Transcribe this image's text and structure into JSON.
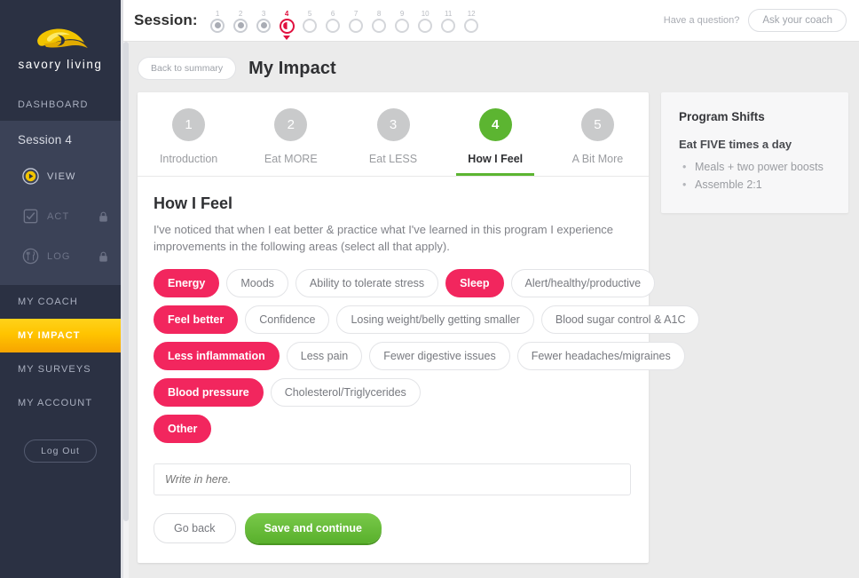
{
  "brand": {
    "name": "savory living",
    "logo_icon": "leaf-swirl-logo",
    "accent": "#ffc400"
  },
  "sidebar": {
    "dashboard_label": "DASHBOARD",
    "session_title": "Session 4",
    "sub_items": [
      {
        "label": "VIEW",
        "icon": "play-circle-icon",
        "locked": false
      },
      {
        "label": "ACT",
        "icon": "checkbox-icon",
        "locked": true
      },
      {
        "label": "LOG",
        "icon": "utensils-circle-icon",
        "locked": true
      }
    ],
    "lower_items": [
      {
        "label": "MY COACH",
        "active": false
      },
      {
        "label": "MY IMPACT",
        "active": true
      },
      {
        "label": "MY SURVEYS",
        "active": false
      },
      {
        "label": "MY ACCOUNT",
        "active": false
      }
    ],
    "logout_label": "Log Out"
  },
  "topbar": {
    "session_label": "Session:",
    "sessions": [
      {
        "num": "1",
        "state": "done"
      },
      {
        "num": "2",
        "state": "done"
      },
      {
        "num": "3",
        "state": "done"
      },
      {
        "num": "4",
        "state": "current"
      },
      {
        "num": "5",
        "state": "upcoming"
      },
      {
        "num": "6",
        "state": "upcoming"
      },
      {
        "num": "7",
        "state": "upcoming"
      },
      {
        "num": "8",
        "state": "upcoming"
      },
      {
        "num": "9",
        "state": "upcoming"
      },
      {
        "num": "10",
        "state": "upcoming"
      },
      {
        "num": "11",
        "state": "upcoming"
      },
      {
        "num": "12",
        "state": "upcoming"
      }
    ],
    "have_question": "Have a question?",
    "coach_button": "Ask your coach",
    "current_marker_color": "#e0113f"
  },
  "page": {
    "back_button": "Back to summary",
    "title": "My Impact"
  },
  "steps": [
    {
      "num": "1",
      "label": "Introduction",
      "active": false
    },
    {
      "num": "2",
      "label": "Eat MORE",
      "active": false
    },
    {
      "num": "3",
      "label": "Eat LESS",
      "active": false
    },
    {
      "num": "4",
      "label": "How I Feel",
      "active": true
    },
    {
      "num": "5",
      "label": "A Bit More",
      "active": false
    }
  ],
  "form": {
    "heading": "How I Feel",
    "lede": "I've noticed that when I eat better & practice what I've learned in this program I experience improvements in the following areas (select all that apply).",
    "selected_color": "#f2265e",
    "chip_rows": [
      [
        {
          "label": "Energy",
          "selected": true
        },
        {
          "label": "Moods",
          "selected": false
        },
        {
          "label": "Ability to tolerate stress",
          "selected": false
        },
        {
          "label": "Sleep",
          "selected": true
        },
        {
          "label": "Alert/healthy/productive",
          "selected": false
        }
      ],
      [
        {
          "label": "Feel better",
          "selected": true
        },
        {
          "label": "Confidence",
          "selected": false
        },
        {
          "label": "Losing weight/belly getting smaller",
          "selected": false
        },
        {
          "label": "Blood sugar control & A1C",
          "selected": false
        }
      ],
      [
        {
          "label": "Less inflammation",
          "selected": true
        },
        {
          "label": "Less pain",
          "selected": false
        },
        {
          "label": "Fewer digestive issues",
          "selected": false
        },
        {
          "label": "Fewer headaches/migraines",
          "selected": false
        }
      ],
      [
        {
          "label": "Blood pressure",
          "selected": true
        },
        {
          "label": "Cholesterol/Triglycerides",
          "selected": false
        }
      ],
      [
        {
          "label": "Other",
          "selected": true
        }
      ]
    ],
    "other_placeholder": "Write in here.",
    "other_value": "",
    "go_back_label": "Go back",
    "save_label": "Save and continue",
    "save_color": "#5cb531"
  },
  "side_panel": {
    "title": "Program Shifts",
    "subtitle": "Eat FIVE times a day",
    "items": [
      "Meals + two power boosts",
      "Assemble 2:1"
    ]
  }
}
